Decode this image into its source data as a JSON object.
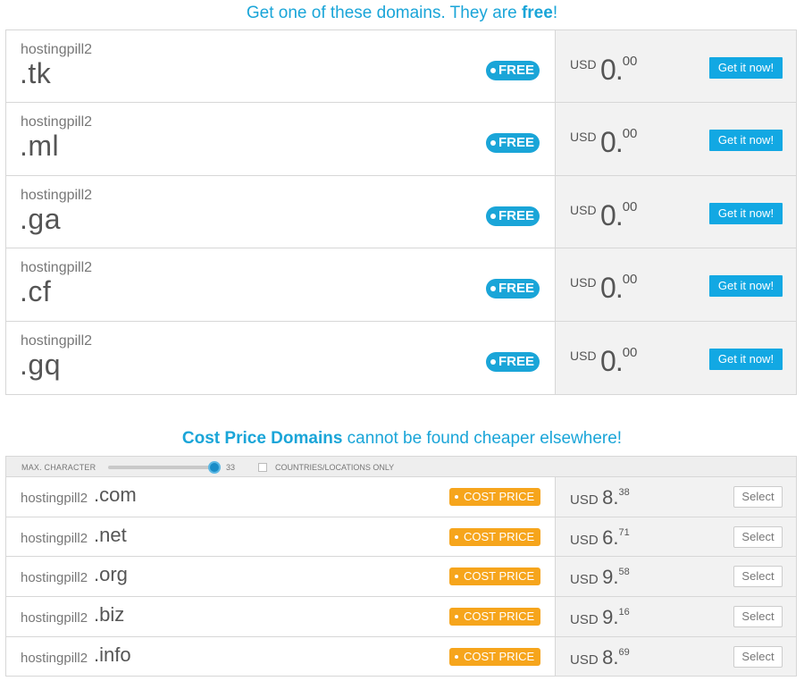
{
  "free_heading": {
    "prefix": "Get one of these domains. They are ",
    "bold": "free",
    "suffix": "!"
  },
  "free_domains": [
    {
      "name": "hostingpill2",
      "tld": ".tk",
      "badge": "FREE",
      "currency": "USD",
      "price_int": "0.",
      "price_dec": "00",
      "button": "Get it now!"
    },
    {
      "name": "hostingpill2",
      "tld": ".ml",
      "badge": "FREE",
      "currency": "USD",
      "price_int": "0.",
      "price_dec": "00",
      "button": "Get it now!"
    },
    {
      "name": "hostingpill2",
      "tld": ".ga",
      "badge": "FREE",
      "currency": "USD",
      "price_int": "0.",
      "price_dec": "00",
      "button": "Get it now!"
    },
    {
      "name": "hostingpill2",
      "tld": ".cf",
      "badge": "FREE",
      "currency": "USD",
      "price_int": "0.",
      "price_dec": "00",
      "button": "Get it now!"
    },
    {
      "name": "hostingpill2",
      "tld": ".gq",
      "badge": "FREE",
      "currency": "USD",
      "price_int": "0.",
      "price_dec": "00",
      "button": "Get it now!"
    }
  ],
  "cost_heading": {
    "bold": "Cost Price Domains",
    "suffix": " cannot be found cheaper elsewhere!"
  },
  "filter": {
    "max_char_label": "MAX. CHARACTER",
    "max_char_value": "33",
    "countries_label": "COUNTRIES/LOCATIONS ONLY"
  },
  "cost_domains": [
    {
      "name": "hostingpill2",
      "tld": ".com",
      "badge": "COST PRICE",
      "currency": "USD",
      "price_int": "8.",
      "price_dec": "38",
      "button": "Select"
    },
    {
      "name": "hostingpill2",
      "tld": ".net",
      "badge": "COST PRICE",
      "currency": "USD",
      "price_int": "6.",
      "price_dec": "71",
      "button": "Select"
    },
    {
      "name": "hostingpill2",
      "tld": ".org",
      "badge": "COST PRICE",
      "currency": "USD",
      "price_int": "9.",
      "price_dec": "58",
      "button": "Select"
    },
    {
      "name": "hostingpill2",
      "tld": ".biz",
      "badge": "COST PRICE",
      "currency": "USD",
      "price_int": "9.",
      "price_dec": "16",
      "button": "Select"
    },
    {
      "name": "hostingpill2",
      "tld": ".info",
      "badge": "COST PRICE",
      "currency": "USD",
      "price_int": "8.",
      "price_dec": "69",
      "button": "Select"
    }
  ],
  "colors": {
    "accent": "#1aa5d8",
    "cost_badge": "#f6a51c",
    "button": "#12a8e3"
  }
}
